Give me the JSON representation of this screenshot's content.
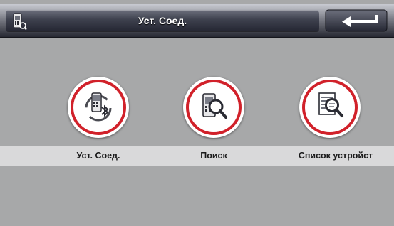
{
  "header": {
    "title": "Уст. Соед.",
    "left_icon": "phone-settings-icon",
    "back_icon": "back-arrow-icon"
  },
  "menu": {
    "items": [
      {
        "label": "Уст. Соед.",
        "icon": "phone-bluetooth-icon"
      },
      {
        "label": "Поиск",
        "icon": "phone-search-icon"
      },
      {
        "label": "Список устройст",
        "icon": "device-list-search-icon"
      }
    ]
  },
  "colors": {
    "accent_ring": "#d1212a",
    "background": "#a7a8a9",
    "label_band": "#d9d9da"
  }
}
